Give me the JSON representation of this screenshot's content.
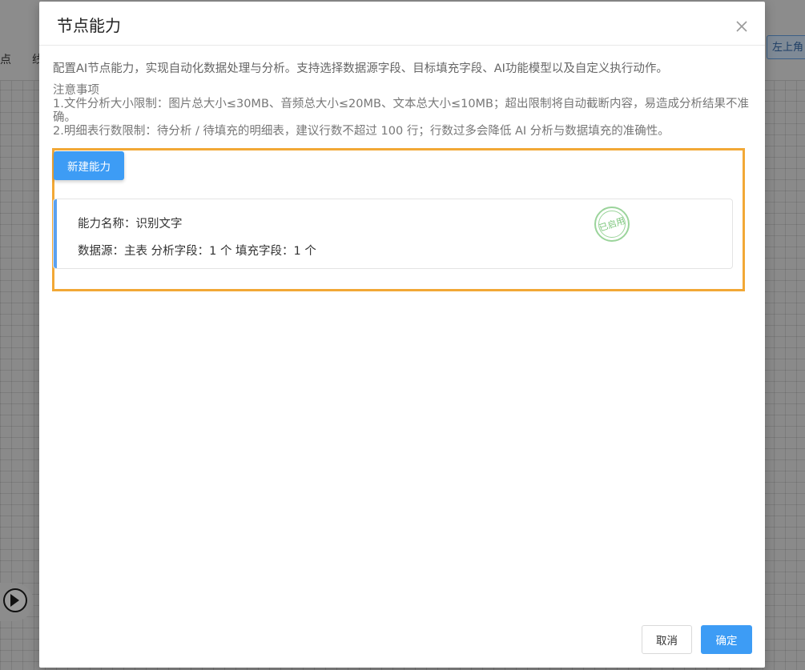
{
  "background": {
    "left_label_1": "点",
    "left_label_2": "线",
    "corner_button": "左上角"
  },
  "modal": {
    "title": "节点能力",
    "description": "配置AI节点能力，实现自动化数据处理与分析。支持选择数据源字段、目标填充字段、AI功能模型以及自定义执行动作。",
    "notes": {
      "heading": "注意事项",
      "item1": "1.文件分析大小限制：图片总大小≤30MB、音频总大小≤20MB、文本总大小≤10MB；超出限制将自动截断内容，易造成分析结果不准确。",
      "item2": "2.明细表行数限制：待分析 / 待填充的明细表，建议行数不超过 100 行；行数过多会降低 AI 分析与数据填充的准确性。"
    },
    "new_button": "新建能力",
    "capability": {
      "name": "能力名称：识别文字",
      "source": "数据源：主表 分析字段：1 个 填充字段：1 个",
      "status": "已启用"
    },
    "footer": {
      "cancel": "取消",
      "confirm": "确定"
    }
  },
  "colors": {
    "primary": "#3d9cf5",
    "highlight": "#f2a836",
    "stamp": "#7cc67c"
  }
}
